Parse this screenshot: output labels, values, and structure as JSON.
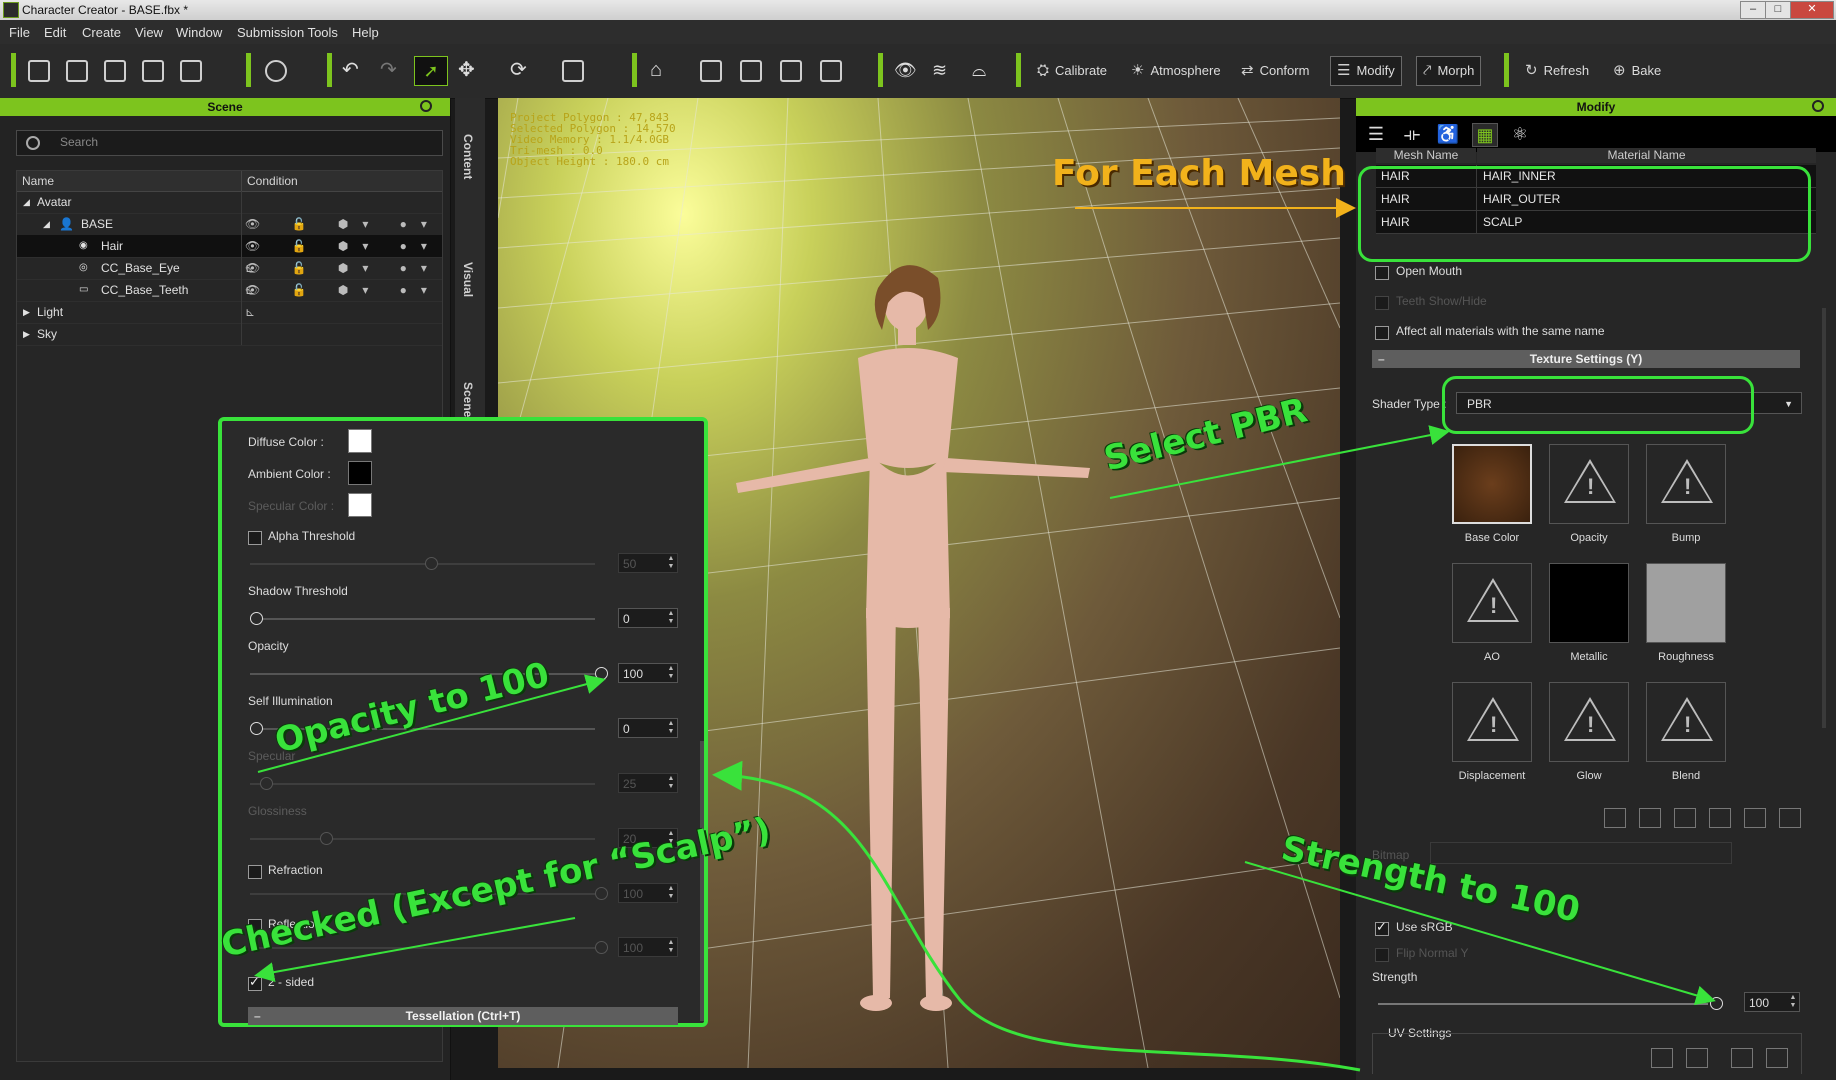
{
  "window": {
    "title": "Character Creator - BASE.fbx *",
    "min": "–",
    "max": "□",
    "close": "✕"
  },
  "menu": [
    "File",
    "Edit",
    "Create",
    "View",
    "Window",
    "Submission Tools",
    "Help"
  ],
  "toolbar": {
    "labeled": [
      {
        "label": "Calibrate",
        "icon": "⛭"
      },
      {
        "label": "Atmosphere",
        "icon": "☀"
      },
      {
        "label": "Conform",
        "icon": "⇄"
      },
      {
        "label": "Modify",
        "icon": "☰"
      },
      {
        "label": "Morph",
        "icon": "⤤"
      },
      {
        "label": "Refresh",
        "icon": "↻"
      },
      {
        "label": "Bake",
        "icon": "⊕"
      }
    ]
  },
  "scene": {
    "title": "Scene",
    "search_placeholder": "Search",
    "columns": [
      "Name",
      "Condition"
    ],
    "rows": [
      {
        "label": "Avatar"
      },
      {
        "label": "BASE"
      },
      {
        "label": "Hair"
      },
      {
        "label": "CC_Base_Eye"
      },
      {
        "label": "CC_Base_Teeth"
      },
      {
        "label": "Light"
      },
      {
        "label": "Sky"
      }
    ],
    "condition_icons": "👁 🔓 ⬢▾ ●▾ ⊾"
  },
  "side_tabs": [
    "Content",
    "Visual",
    "Scene"
  ],
  "viewport": {
    "info_lines": [
      "Project Polygon : 47,843",
      "Selected Polygon : 14,570",
      "Video Memory : 1.1/4.0GB",
      "Tri-mesh : 0.0",
      "Object Height : 180.0 cm"
    ]
  },
  "material_panel": {
    "diffuse_label": "Diffuse Color :",
    "ambient_label": "Ambient Color :",
    "specular_label": "Specular Color :",
    "alpha_label": "Alpha Threshold",
    "alpha_value": "50",
    "shadow_label": "Shadow Threshold",
    "shadow_value": "0",
    "opacity_label": "Opacity",
    "opacity_value": "100",
    "selfillum_label": "Self Illumination",
    "selfillum_value": "0",
    "specular2_label": "Specular",
    "specular2_value": "25",
    "gloss_label": "Glossiness",
    "gloss_value": "20",
    "refraction_label": "Refraction",
    "refraction_value": "100",
    "reflection_label": "Reflection",
    "reflection_value": "100",
    "twosided_label": "2 - sided",
    "tess_label": "Tessellation (Ctrl+T)",
    "colors": {
      "diffuse": "#ffffff",
      "ambient": "#000000",
      "specular": "#ffffff"
    }
  },
  "modify": {
    "title": "Modify",
    "table_headers": [
      "Mesh Name",
      "Material Name"
    ],
    "rows": [
      {
        "mesh": "HAIR",
        "material": "HAIR_INNER"
      },
      {
        "mesh": "HAIR",
        "material": "HAIR_OUTER"
      },
      {
        "mesh": "HAIR",
        "material": "SCALP"
      }
    ],
    "open_mouth": "Open Mouth",
    "teeth": "Teeth Show/Hide",
    "affect_all": "Affect all materials with the same name",
    "texture_settings": "Texture Settings  (Y)",
    "shader_label": "Shader Type :",
    "shader_value": "PBR",
    "slots": [
      {
        "label": "Base Color"
      },
      {
        "label": "Opacity"
      },
      {
        "label": "Bump"
      },
      {
        "label": "AO"
      },
      {
        "label": "Metallic"
      },
      {
        "label": "Roughness"
      },
      {
        "label": "Displacement"
      },
      {
        "label": "Glow"
      },
      {
        "label": "Blend"
      }
    ],
    "bitmap_label": "Bitmap",
    "use_srgb": "Use sRGB",
    "flip_normal": "Flip Normal Y",
    "strength_label": "Strength",
    "strength_value": "100",
    "uv_settings": "UV Settings"
  },
  "annotations": {
    "for_each_mesh": "For Each Mesh",
    "select_pbr": "Select PBR",
    "opacity_100": "Opacity to 100",
    "checked": "Checked (Except for “Scalp”)",
    "strength_100": "Strength to 100",
    "accent": "#39e23b"
  }
}
